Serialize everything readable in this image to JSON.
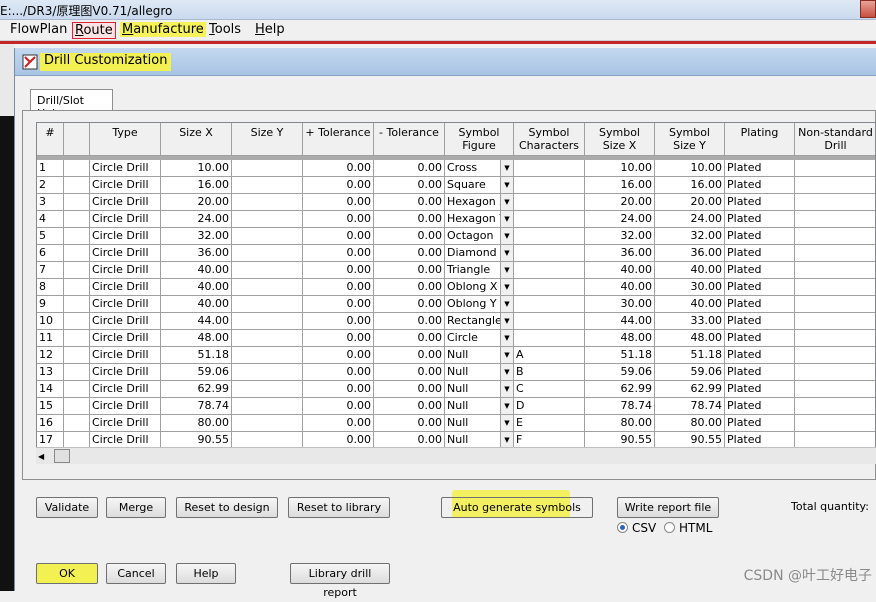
{
  "app": {
    "title": "E:.../DR3/原理图V0.71/allegro",
    "menu": [
      {
        "label": "FlowPlan",
        "mnemonic": ""
      },
      {
        "label": "Route",
        "mnemonic": "R"
      },
      {
        "label": "Manufacture",
        "mnemonic": "M"
      },
      {
        "label": "Tools",
        "mnemonic": "T"
      },
      {
        "label": "Help",
        "mnemonic": "H"
      }
    ]
  },
  "dialog": {
    "title": "Drill Customization",
    "tab": "Drill/Slot Holes",
    "columns": [
      "#",
      "",
      "Type",
      "Size X",
      "Size Y",
      "+ Tolerance",
      "- Tolerance",
      "Symbol Figure",
      "Symbol Characters",
      "Symbol Size X",
      "Symbol Size Y",
      "Plating",
      "Non-standard Drill"
    ],
    "rows": [
      {
        "n": "1",
        "type": "Circle Drill",
        "sx": "10.00",
        "sy": "",
        "tp": "0.00",
        "tm": "0.00",
        "fig": "Cross",
        "chr": "",
        "ssx": "10.00",
        "ssy": "10.00",
        "plat": "Plated"
      },
      {
        "n": "2",
        "type": "Circle Drill",
        "sx": "16.00",
        "sy": "",
        "tp": "0.00",
        "tm": "0.00",
        "fig": "Square",
        "chr": "",
        "ssx": "16.00",
        "ssy": "16.00",
        "plat": "Plated"
      },
      {
        "n": "3",
        "type": "Circle Drill",
        "sx": "20.00",
        "sy": "",
        "tp": "0.00",
        "tm": "0.00",
        "fig": "Hexagon X",
        "chr": "",
        "ssx": "20.00",
        "ssy": "20.00",
        "plat": "Plated"
      },
      {
        "n": "4",
        "type": "Circle Drill",
        "sx": "24.00",
        "sy": "",
        "tp": "0.00",
        "tm": "0.00",
        "fig": "Hexagon Y",
        "chr": "",
        "ssx": "24.00",
        "ssy": "24.00",
        "plat": "Plated"
      },
      {
        "n": "5",
        "type": "Circle Drill",
        "sx": "32.00",
        "sy": "",
        "tp": "0.00",
        "tm": "0.00",
        "fig": "Octagon",
        "chr": "",
        "ssx": "32.00",
        "ssy": "32.00",
        "plat": "Plated"
      },
      {
        "n": "6",
        "type": "Circle Drill",
        "sx": "36.00",
        "sy": "",
        "tp": "0.00",
        "tm": "0.00",
        "fig": "Diamond",
        "chr": "",
        "ssx": "36.00",
        "ssy": "36.00",
        "plat": "Plated"
      },
      {
        "n": "7",
        "type": "Circle Drill",
        "sx": "40.00",
        "sy": "",
        "tp": "0.00",
        "tm": "0.00",
        "fig": "Triangle",
        "chr": "",
        "ssx": "40.00",
        "ssy": "40.00",
        "plat": "Plated"
      },
      {
        "n": "8",
        "type": "Circle Drill",
        "sx": "40.00",
        "sy": "",
        "tp": "0.00",
        "tm": "0.00",
        "fig": "Oblong X",
        "chr": "",
        "ssx": "40.00",
        "ssy": "30.00",
        "plat": "Plated"
      },
      {
        "n": "9",
        "type": "Circle Drill",
        "sx": "40.00",
        "sy": "",
        "tp": "0.00",
        "tm": "0.00",
        "fig": "Oblong Y",
        "chr": "",
        "ssx": "30.00",
        "ssy": "40.00",
        "plat": "Plated"
      },
      {
        "n": "10",
        "type": "Circle Drill",
        "sx": "44.00",
        "sy": "",
        "tp": "0.00",
        "tm": "0.00",
        "fig": "Rectangle",
        "chr": "",
        "ssx": "44.00",
        "ssy": "33.00",
        "plat": "Plated"
      },
      {
        "n": "11",
        "type": "Circle Drill",
        "sx": "48.00",
        "sy": "",
        "tp": "0.00",
        "tm": "0.00",
        "fig": "Circle",
        "chr": "",
        "ssx": "48.00",
        "ssy": "48.00",
        "plat": "Plated"
      },
      {
        "n": "12",
        "type": "Circle Drill",
        "sx": "51.18",
        "sy": "",
        "tp": "0.00",
        "tm": "0.00",
        "fig": "Null",
        "chr": "A",
        "ssx": "51.18",
        "ssy": "51.18",
        "plat": "Plated"
      },
      {
        "n": "13",
        "type": "Circle Drill",
        "sx": "59.06",
        "sy": "",
        "tp": "0.00",
        "tm": "0.00",
        "fig": "Null",
        "chr": "B",
        "ssx": "59.06",
        "ssy": "59.06",
        "plat": "Plated"
      },
      {
        "n": "14",
        "type": "Circle Drill",
        "sx": "62.99",
        "sy": "",
        "tp": "0.00",
        "tm": "0.00",
        "fig": "Null",
        "chr": "C",
        "ssx": "62.99",
        "ssy": "62.99",
        "plat": "Plated"
      },
      {
        "n": "15",
        "type": "Circle Drill",
        "sx": "78.74",
        "sy": "",
        "tp": "0.00",
        "tm": "0.00",
        "fig": "Null",
        "chr": "D",
        "ssx": "78.74",
        "ssy": "78.74",
        "plat": "Plated"
      },
      {
        "n": "16",
        "type": "Circle Drill",
        "sx": "80.00",
        "sy": "",
        "tp": "0.00",
        "tm": "0.00",
        "fig": "Null",
        "chr": "E",
        "ssx": "80.00",
        "ssy": "80.00",
        "plat": "Plated"
      },
      {
        "n": "17",
        "type": "Circle Drill",
        "sx": "90.55",
        "sy": "",
        "tp": "0.00",
        "tm": "0.00",
        "fig": "Null",
        "chr": "F",
        "ssx": "90.55",
        "ssy": "90.55",
        "plat": "Plated"
      }
    ],
    "buttons": {
      "validate": "Validate",
      "merge": "Merge",
      "reset_design": "Reset to design",
      "reset_library": "Reset to library",
      "auto_generate": "Auto generate symbols",
      "write_report": "Write report file",
      "ok": "OK",
      "cancel": "Cancel",
      "help": "Help",
      "library_report": "Library drill report"
    },
    "report_format": {
      "options": [
        "CSV",
        "HTML"
      ],
      "selected": "CSV"
    },
    "total_quantity_label": "Total quantity:"
  },
  "watermark": "CSDN @叶工好电子",
  "colors": {
    "highlight": "#f3f052",
    "route_box": "#d23"
  }
}
